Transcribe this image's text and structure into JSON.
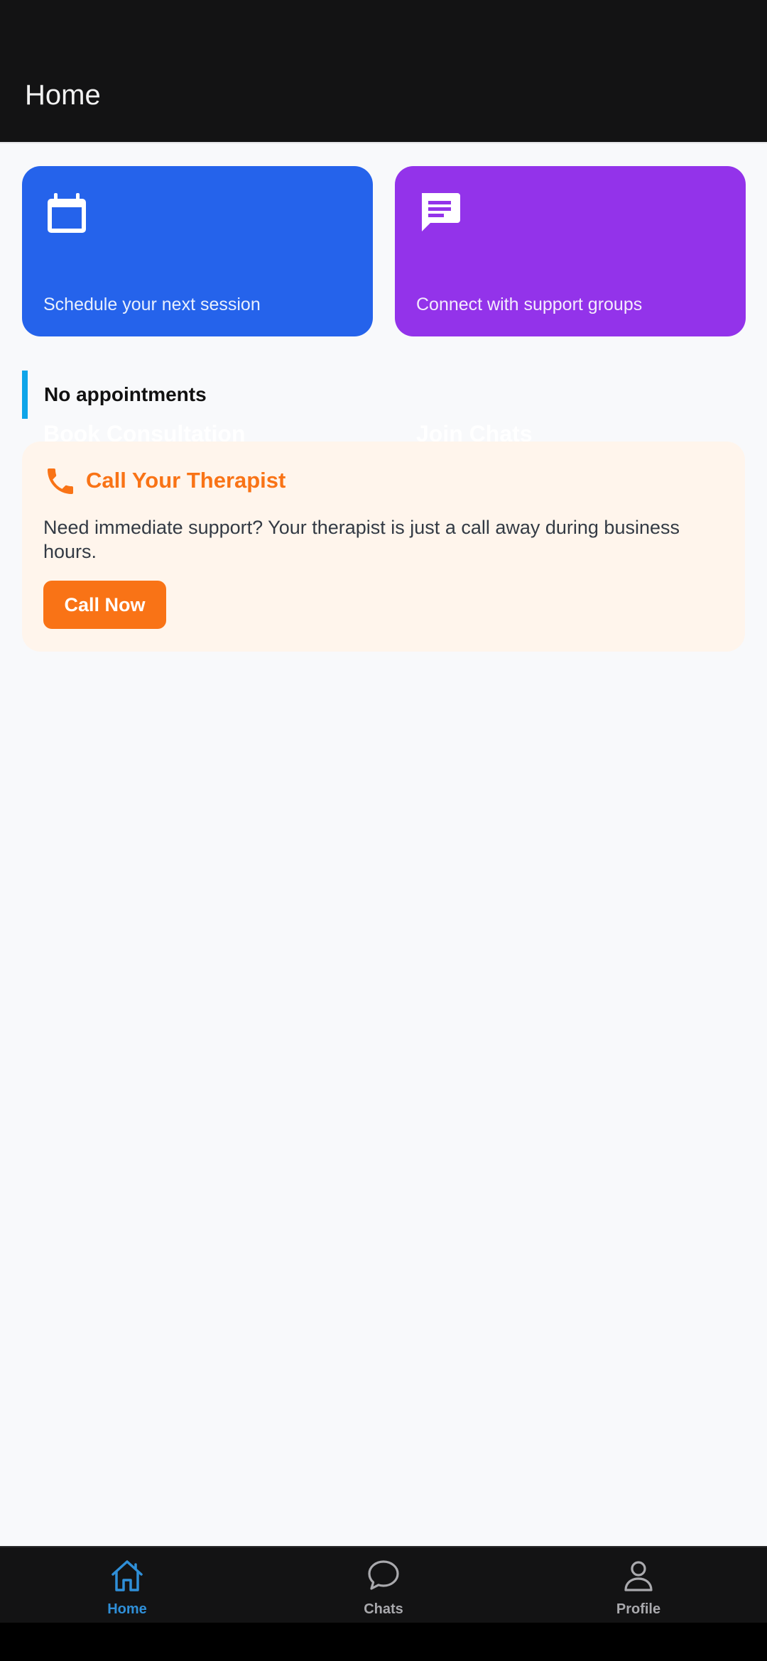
{
  "app_bar": {
    "title": "Home"
  },
  "cards": {
    "book": {
      "title": "Book Consultation",
      "subtitle": "Schedule your next session",
      "icon": "calendar-icon",
      "color": "#2563eb"
    },
    "chats": {
      "title": "Join Chats",
      "subtitle": "Connect with support groups",
      "icon": "chat-bubble-icon",
      "color": "#9333ea"
    }
  },
  "appointments": {
    "empty_text": "No appointments",
    "accent": "#0ea5e9"
  },
  "therapist": {
    "icon": "phone-icon",
    "title": "Call Your Therapist",
    "body": "Need immediate support? Your therapist is just a call away during business hours.",
    "button_label": "Call Now",
    "accent": "#f97316"
  },
  "bottom_nav": {
    "items": [
      {
        "label": "Home",
        "icon": "home-icon",
        "active": true,
        "color": "#2f8fd8"
      },
      {
        "label": "Chats",
        "icon": "chat-icon",
        "active": false,
        "color": "#a9a9ad"
      },
      {
        "label": "Profile",
        "icon": "profile-icon",
        "active": false,
        "color": "#a9a9ad"
      }
    ]
  }
}
